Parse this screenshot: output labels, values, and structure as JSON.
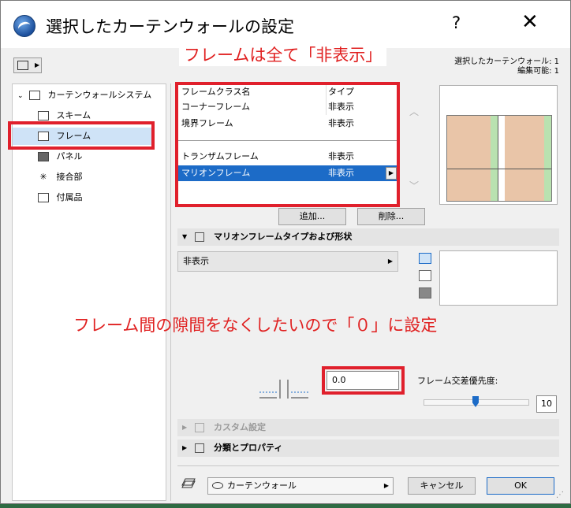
{
  "window": {
    "title": "選択したカーテンウォールの設定",
    "help": "?",
    "close": "✕"
  },
  "annotations": {
    "top": "フレームは全て「非表示」",
    "middle": "フレーム間の隙間をなくしたいので「０」に設定"
  },
  "header_info": {
    "line1": "選択したカーテンウォール: 1",
    "line2": "編集可能: 1"
  },
  "tree": {
    "root": "カーテンウォールシステム",
    "items": [
      {
        "label": "スキーム",
        "icon": "scheme-icon"
      },
      {
        "label": "フレーム",
        "icon": "frame-icon",
        "selected": true
      },
      {
        "label": "パネル",
        "icon": "panel-icon"
      },
      {
        "label": "接合部",
        "icon": "junction-icon"
      },
      {
        "label": "付属品",
        "icon": "accessory-icon"
      }
    ]
  },
  "frame_list": {
    "header": {
      "name": "フレームクラス名",
      "type": "タイプ"
    },
    "rows": [
      {
        "name": "コーナーフレーム",
        "type": "非表示"
      },
      {
        "name": "境界フレーム",
        "type": "非表示"
      },
      {
        "name": "トランザムフレーム",
        "type": "非表示"
      },
      {
        "name": "マリオンフレーム",
        "type": "非表示",
        "selected": true
      }
    ]
  },
  "buttons": {
    "add": "追加...",
    "delete": "削除...",
    "cancel": "キャンセル",
    "ok": "OK"
  },
  "sections": {
    "mullion_type": "マリオンフレームタイプおよび形状",
    "custom": "カスタム設定",
    "classification": "分類とプロパティ"
  },
  "type_select": {
    "value": "非表示"
  },
  "gap": {
    "value": "0.0"
  },
  "priority": {
    "label": "フレーム交差優先度:",
    "value": "10",
    "level": 0.5
  },
  "layer": {
    "value": "カーテンウォール"
  },
  "colors": {
    "accent": "#1c6bc7",
    "annotation": "#e0202c",
    "pane": "#e9c5a8",
    "mullion": "#b9e2b0"
  }
}
